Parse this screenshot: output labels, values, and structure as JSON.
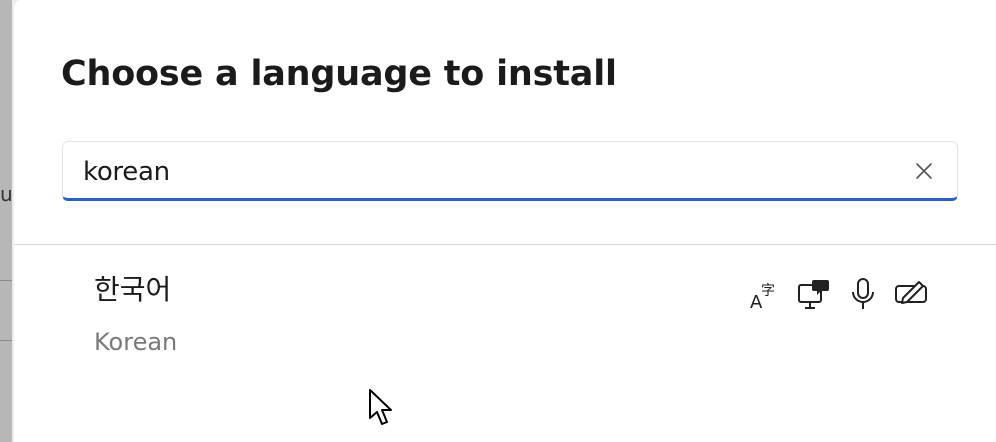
{
  "backdrop": {
    "partial_char": "u"
  },
  "dialog": {
    "title": "Choose a language to install",
    "search": {
      "value": "korean",
      "clear_label": "Clear"
    }
  },
  "results": [
    {
      "native_name": "한국어",
      "english_name": "Korean",
      "features": [
        {
          "icon": "language-pack-icon",
          "label": "Language pack"
        },
        {
          "icon": "text-to-speech-icon",
          "label": "Text-to-speech"
        },
        {
          "icon": "speech-recognition-icon",
          "label": "Speech recognition"
        },
        {
          "icon": "handwriting-icon",
          "label": "Handwriting"
        }
      ]
    }
  ],
  "colors": {
    "accent": "#2a62c4",
    "title_text": "#1b1b1b",
    "secondary_text": "#7a7a7a",
    "divider": "#d8d8d8"
  }
}
